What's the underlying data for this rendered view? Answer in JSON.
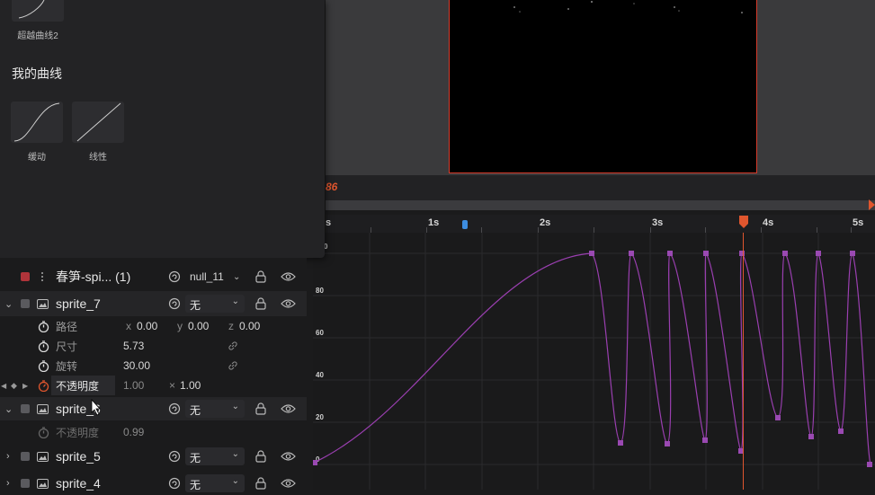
{
  "curve_library": {
    "top_partial_curve_label": "超越曲线2",
    "section_title": "我的曲线",
    "curves": [
      {
        "icon": "ease-curve-icon",
        "label": "缓动"
      },
      {
        "icon": "linear-curve-icon",
        "label": "线性"
      }
    ]
  },
  "timeline": {
    "current_time": "86",
    "ruler": {
      "labels": [
        "s",
        "1s",
        "2s",
        "3s",
        "4s",
        "5s"
      ],
      "playhead_color": "#e0562e"
    },
    "graph": {
      "y_labels": [
        "0",
        "80",
        "60",
        "40",
        "20",
        "0"
      ],
      "curve_color": "#9a3fb0",
      "keyframe_color": "#9a49b2"
    }
  },
  "layers": [
    {
      "name": "春笋-spi... (1)",
      "parent": "null_11",
      "expanded": false,
      "color": "#b0343a"
    },
    {
      "name": "sprite_7",
      "parent": "无",
      "expanded": true,
      "color": "#5a5a5e",
      "properties": {
        "position": {
          "label": "路径",
          "x_label": "x",
          "x": "0.00",
          "y_label": "y",
          "y": "0.00",
          "z_label": "z",
          "z": "0.00"
        },
        "size": {
          "label": "尺寸",
          "value": "5.73"
        },
        "rotation": {
          "label": "旋转",
          "value": "30.00"
        },
        "opacity": {
          "label": "不透明度",
          "value": "1.00",
          "multiplier_label": "×",
          "multiplier": "1.00"
        }
      }
    },
    {
      "name": "sprite_6",
      "parent": "无",
      "expanded": true,
      "color": "#5a5a5e",
      "properties": {
        "opacity": {
          "label": "不透明度",
          "value": "0.99"
        }
      }
    },
    {
      "name": "sprite_5",
      "parent": "无",
      "expanded": false,
      "color": "#5a5a5e"
    },
    {
      "name": "sprite_4",
      "parent": "无",
      "expanded": false,
      "color": "#5a5a5e"
    }
  ],
  "colors": {
    "accent": "#e0562e",
    "panel_bg": "#232325",
    "canvas_border": "#d63a2a"
  }
}
